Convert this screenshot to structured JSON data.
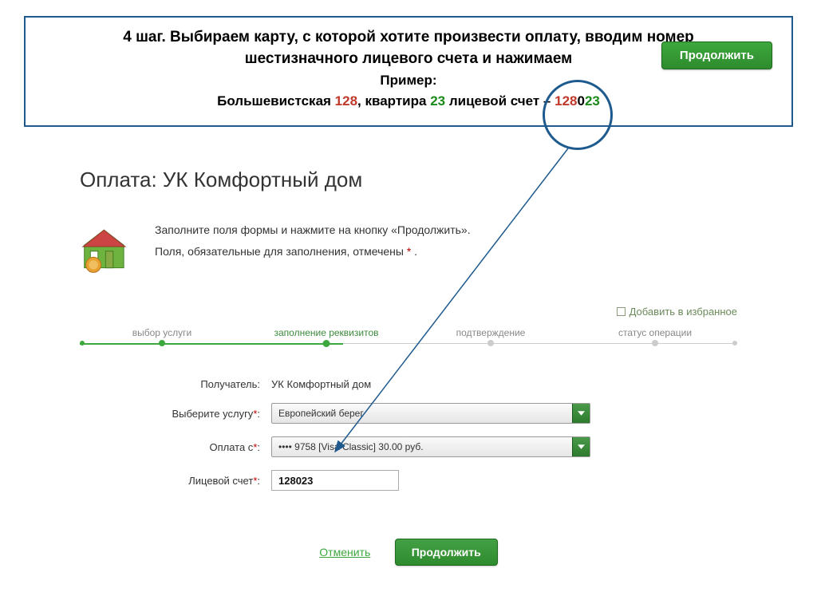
{
  "instruction": {
    "line1_a": "4 шаг. Выбираем карту, с которой хотите произвести оплату, вводим номер",
    "line1_b": "шестизначного лицевого счета и нажимаем",
    "example_label": "Пример:",
    "example_prefix": "Большевистская ",
    "example_n1": "128",
    "example_mid1": ", квартира ",
    "example_n2": "23",
    "example_mid2": " лицевой счет – ",
    "example_c1": "128",
    "example_c2": "0",
    "example_c3": "23"
  },
  "buttons": {
    "continue": "Продолжить",
    "cancel": "Отменить"
  },
  "page": {
    "title": "Оплата: УК Комфортный дом",
    "hint1": "Заполните поля формы и нажмите на кнопку «Продолжить».",
    "hint2": "Поля, обязательные для заполнения, отмечены ",
    "hint2_ast": "*",
    "hint2_end": " .",
    "favorite": "Добавить в избранное"
  },
  "steps": {
    "s1": "выбор услуги",
    "s2": "заполнение реквизитов",
    "s3": "подтверждение",
    "s4": "статус операции"
  },
  "form": {
    "recipient_label": "Получатель:",
    "recipient_value": "УК Комфортный дом",
    "service_label": "Выберите услугу",
    "service_value": "Европейский берег",
    "card_label": "Оплата с",
    "card_value": "•••• 9758 [Visa Classic] 30.00 руб.",
    "account_label": "Лицевой счет",
    "account_value": "128023"
  }
}
